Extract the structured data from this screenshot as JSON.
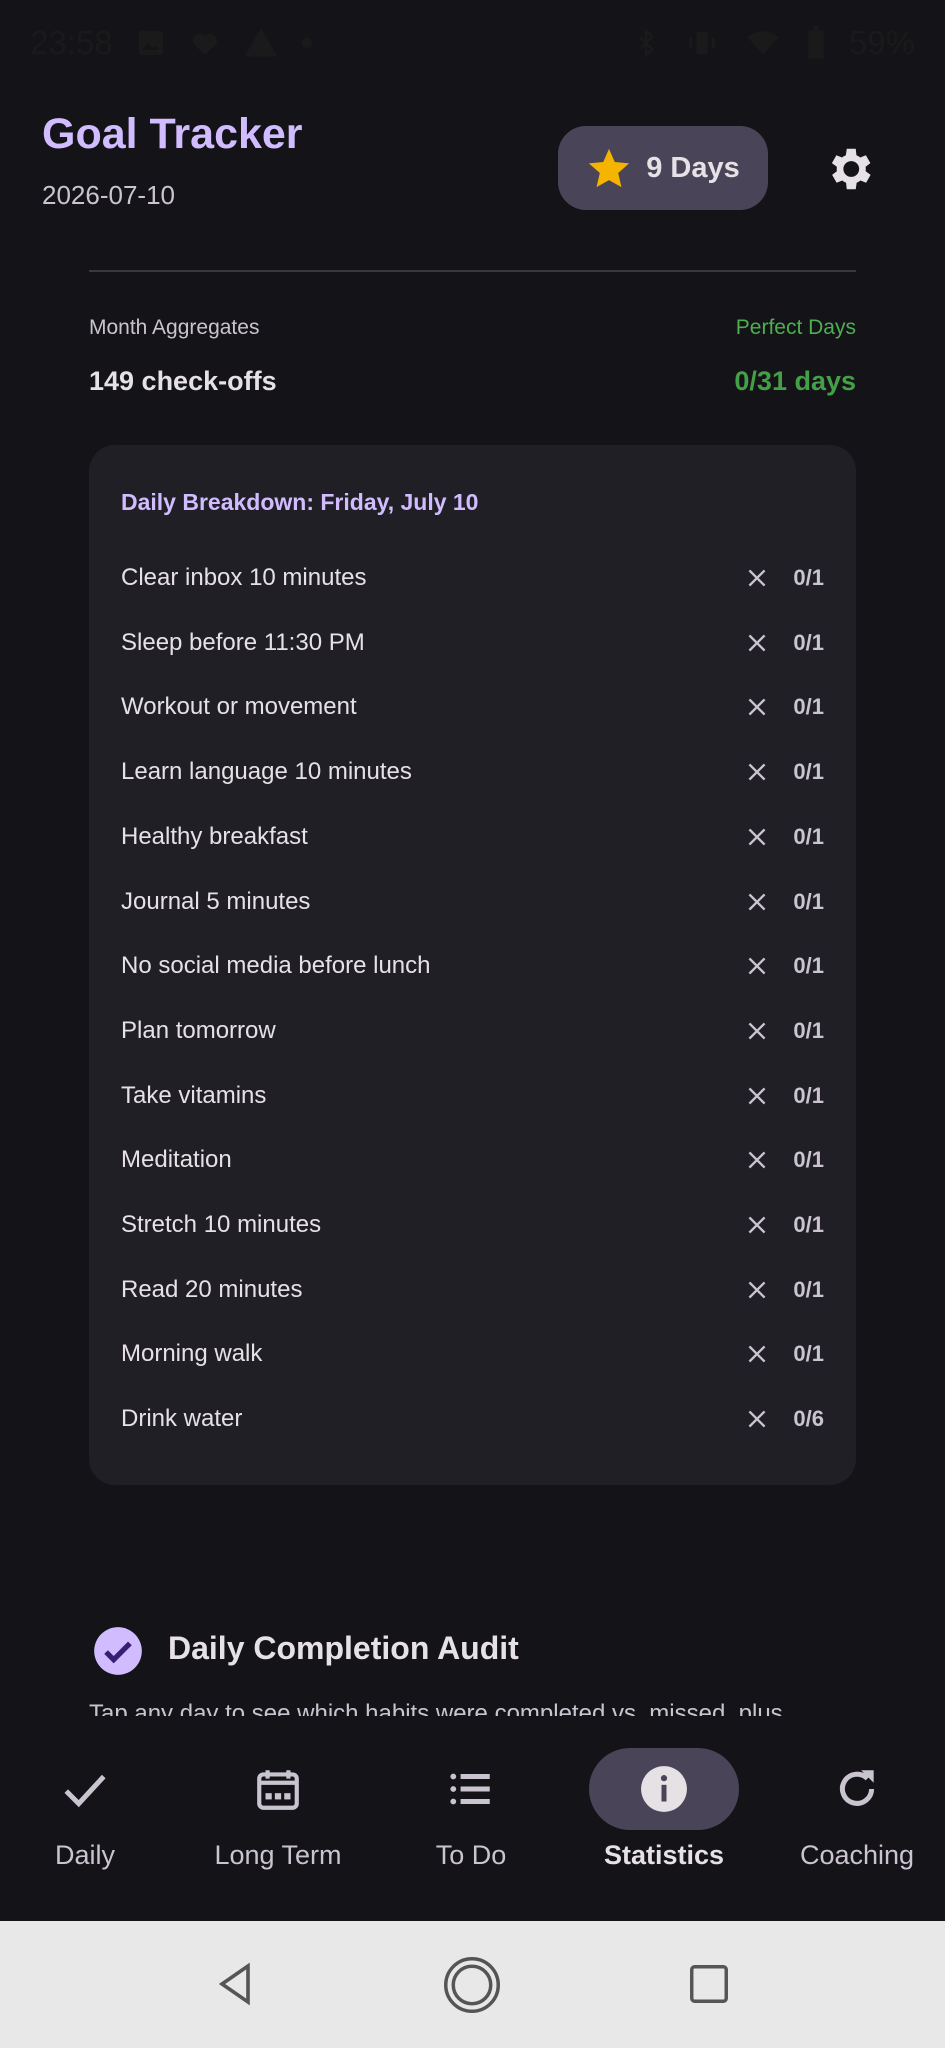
{
  "status_bar": {
    "time": "23:58",
    "battery": "59%"
  },
  "header": {
    "title": "Goal Tracker",
    "date": "2026-07-10",
    "streak_label": "9 Days"
  },
  "month": {
    "aggregates_label": "Month Aggregates",
    "aggregates_value": "149 check-offs",
    "perfect_label": "Perfect Days",
    "perfect_value": "0/31 days"
  },
  "breakdown": {
    "title": "Daily Breakdown: Friday, July 10",
    "habits": [
      {
        "name": "Clear inbox 10 minutes",
        "count": "0/1"
      },
      {
        "name": "Sleep before 11:30 PM",
        "count": "0/1"
      },
      {
        "name": "Workout or movement",
        "count": "0/1"
      },
      {
        "name": "Learn language 10 minutes",
        "count": "0/1"
      },
      {
        "name": "Healthy breakfast",
        "count": "0/1"
      },
      {
        "name": "Journal 5 minutes",
        "count": "0/1"
      },
      {
        "name": "No social media before lunch",
        "count": "0/1"
      },
      {
        "name": "Plan tomorrow",
        "count": "0/1"
      },
      {
        "name": "Take vitamins",
        "count": "0/1"
      },
      {
        "name": "Meditation",
        "count": "0/1"
      },
      {
        "name": "Stretch 10 minutes",
        "count": "0/1"
      },
      {
        "name": "Read 20 minutes",
        "count": "0/1"
      },
      {
        "name": "Morning walk",
        "count": "0/1"
      },
      {
        "name": "Drink water",
        "count": "0/6"
      }
    ]
  },
  "audit": {
    "title": "Daily Completion Audit",
    "description": "Tap any day to see which habits were completed vs. missed, plus"
  },
  "bottom_nav": {
    "items": [
      {
        "label": "Daily",
        "icon": "check-icon",
        "active": false
      },
      {
        "label": "Long Term",
        "icon": "calendar-icon",
        "active": false
      },
      {
        "label": "To Do",
        "icon": "list-icon",
        "active": false
      },
      {
        "label": "Statistics",
        "icon": "info-icon",
        "active": true
      },
      {
        "label": "Coaching",
        "icon": "refresh-icon",
        "active": false
      }
    ]
  },
  "colors": {
    "accent": "#d0bcff",
    "success": "#43a047",
    "background": "#141317",
    "card": "#211f26",
    "pill": "#4a4458",
    "star": "#f4b400"
  }
}
